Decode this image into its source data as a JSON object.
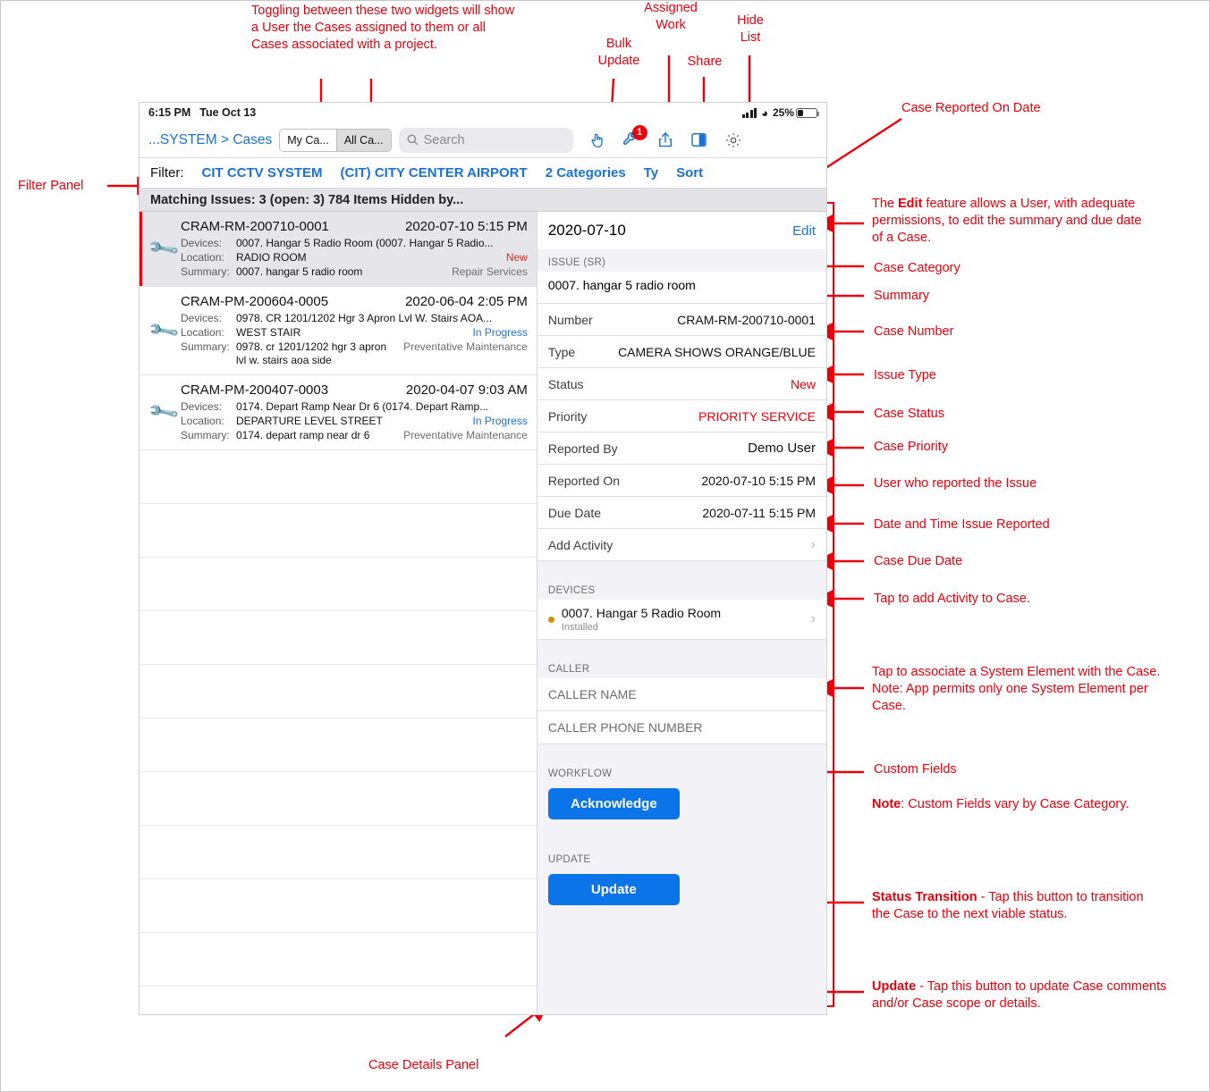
{
  "status_bar": {
    "time": "6:15 PM",
    "date": "Tue Oct 13",
    "battery_pct": "25%"
  },
  "nav": {
    "breadcrumb": "...SYSTEM > Cases",
    "segment": [
      {
        "label": "My Ca...",
        "active": false
      },
      {
        "label": "All Ca...",
        "active": true
      }
    ],
    "search_placeholder": "Search",
    "icons": [
      {
        "name": "bulk-update-icon",
        "glyph": "☝"
      },
      {
        "name": "assigned-work-icon",
        "glyph": "⚒",
        "badge": "1"
      },
      {
        "name": "share-icon",
        "glyph": "⇧"
      },
      {
        "name": "hide-list-icon",
        "glyph": "◧"
      },
      {
        "name": "settings-gear-icon",
        "glyph": "⚙"
      }
    ]
  },
  "filter_bar": {
    "label": "Filter:",
    "items": [
      "CIT CCTV SYSTEM",
      "(CIT) CITY CENTER AIRPORT",
      "2 Categories",
      "Ty",
      "Sort"
    ]
  },
  "list_header": "Matching Issues: 3 (open: 3) 784 Items Hidden by...",
  "cases": [
    {
      "number": "CRAM-RM-200710-0001",
      "date": "2020-07-10 5:15 PM",
      "devices_label": "Devices:",
      "devices": "0007. Hangar 5 Radio Room (0007. Hangar 5 Radio...",
      "location_label": "Location:",
      "location": "RADIO ROOM",
      "status": "New",
      "status_style": "red",
      "summary_label": "Summary:",
      "summary": "0007. hangar 5 radio room",
      "category": "Repair Services",
      "icon_color": "red",
      "selected": true
    },
    {
      "number": "CRAM-PM-200604-0005",
      "date": "2020-06-04 2:05 PM",
      "devices_label": "Devices:",
      "devices": "0978. CR 1201/1202 Hgr 3 Apron Lvl W. Stairs AOA...",
      "location_label": "Location:",
      "location": "WEST STAIR",
      "status": "In Progress",
      "status_style": "blue",
      "summary_label": "Summary:",
      "summary": "0978. cr 1201/1202 hgr 3 apron lvl w. stairs aoa side",
      "category": "Preventative Maintenance",
      "icon_color": "yellow",
      "selected": false
    },
    {
      "number": "CRAM-PM-200407-0003",
      "date": "2020-04-07 9:03 AM",
      "devices_label": "Devices:",
      "devices": "0174. Depart Ramp Near Dr 6 (0174. Depart Ramp...",
      "location_label": "Location:",
      "location": "DEPARTURE LEVEL STREET",
      "status": "In Progress",
      "status_style": "blue",
      "summary_label": "Summary:",
      "summary": "0174. depart ramp near dr 6",
      "category": "Preventative Maintenance",
      "icon_color": "yellow",
      "selected": false
    }
  ],
  "detail": {
    "title": "2020-07-10",
    "edit_label": "Edit",
    "category_header": "ISSUE (SR)",
    "summary": "0007. hangar 5 radio room",
    "fields": [
      {
        "key": "Number",
        "value": "CRAM-RM-200710-0001",
        "style": ""
      },
      {
        "key": "Type",
        "value": "CAMERA SHOWS ORANGE/BLUE",
        "style": ""
      },
      {
        "key": "Status",
        "value": "New",
        "style": "red"
      },
      {
        "key": "Priority",
        "value": "PRIORITY SERVICE",
        "style": "red"
      },
      {
        "key": "Reported By",
        "value": "Demo User",
        "style": ""
      },
      {
        "key": "Reported On",
        "value": "2020-07-10 5:15 PM",
        "style": ""
      },
      {
        "key": "Due Date",
        "value": "2020-07-11 5:15 PM",
        "style": ""
      }
    ],
    "add_activity": "Add Activity",
    "devices_header": "DEVICES",
    "device": {
      "name": "0007. Hangar 5 Radio Room",
      "state": "Installed"
    },
    "caller_header": "CALLER",
    "caller_fields": [
      "CALLER NAME",
      "CALLER PHONE NUMBER"
    ],
    "workflow_header": "WORKFLOW",
    "workflow_button": "Acknowledge",
    "update_header": "UPDATE",
    "update_button": "Update"
  },
  "annotations": {
    "toggle_widgets": "Toggling between these two widgets will show a User the Cases assigned to them or all Cases associated with a project.",
    "bulk_update": "Bulk\nUpdate",
    "assigned_work": "Assigned\nWork",
    "share": "Share",
    "hide_list": "Hide\nList",
    "case_reported_on": "Case Reported On Date",
    "filter_panel": "Filter Panel",
    "edit_feature_pre": "The ",
    "edit_feature_bold": "Edit",
    "edit_feature_post": " feature allows a User, with adequate permissions, to edit the summary and due date of a Case.",
    "case_category": "Case Category",
    "summary": "Summary",
    "case_number": "Case Number",
    "issue_type": "Issue Type",
    "case_status": "Case Status",
    "case_priority": "Case Priority",
    "reported_by": "User who reported the Issue",
    "reported_on": "Date and Time Issue Reported",
    "due_date": "Case Due Date",
    "add_activity": "Tap to add Activity to Case.",
    "associate_element": "Tap to associate a System Element with the Case. Note: App permits only one System Element per Case.",
    "custom_fields": "Custom Fields",
    "note_bold": "Note",
    "note_rest": ": Custom Fields vary by Case Category.",
    "status_transition_bold": "Status Transition",
    "status_transition_rest": " - Tap this button to transition the Case to the next viable status.",
    "update_bold": "Update",
    "update_rest": " - Tap this button to update Case comments and/or Case scope or details.",
    "case_details_panel": "Case Details Panel"
  },
  "colors": {
    "annotation": "#e8000d",
    "link": "#1b72d0",
    "button": "#0a74e8"
  }
}
